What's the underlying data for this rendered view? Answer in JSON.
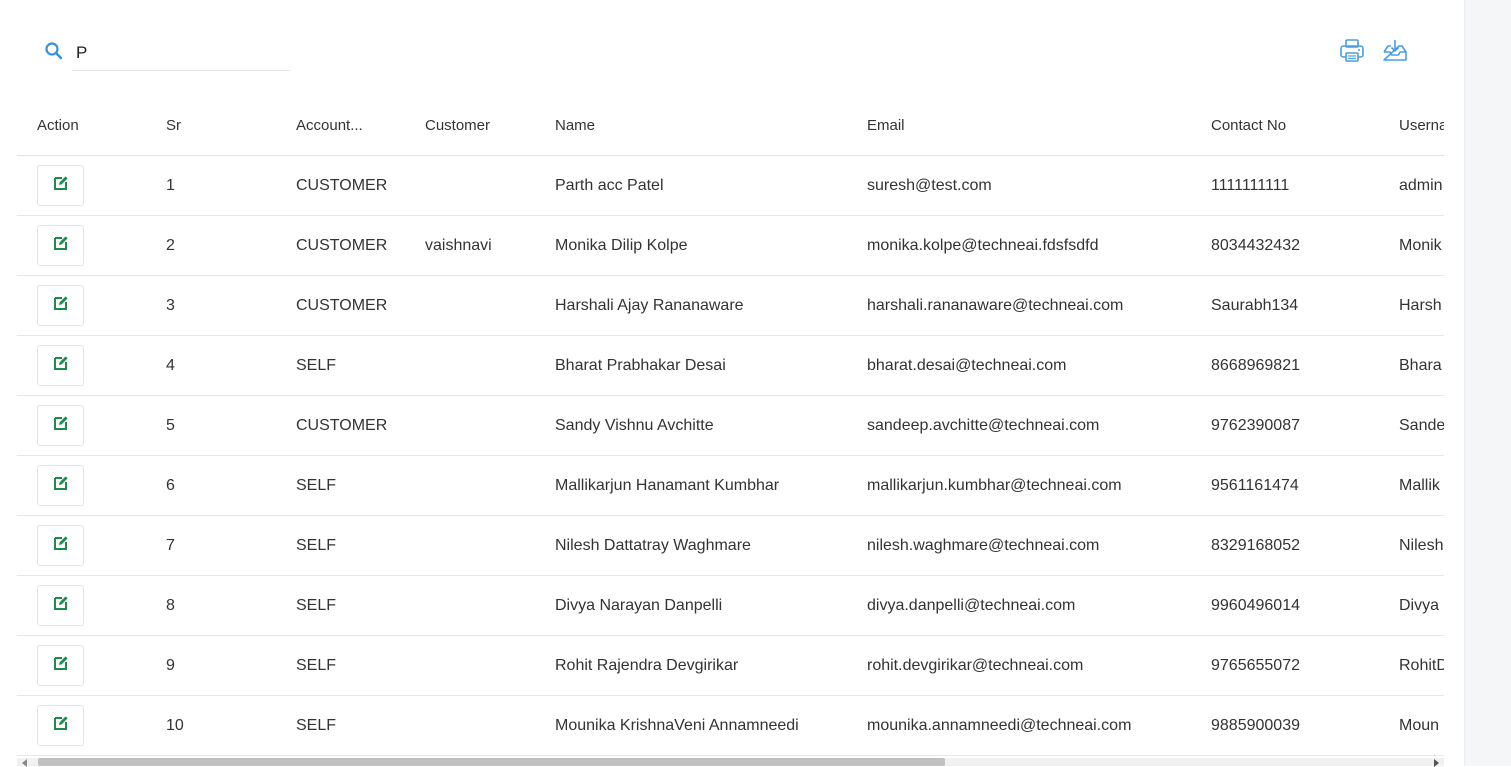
{
  "search": {
    "value": "P",
    "placeholder": ""
  },
  "toolbar": {
    "print_icon": "printer-icon",
    "download_icon": "download-tray-icon"
  },
  "colors": {
    "accent": "#3a8fd6",
    "edit_icon": "#1e8a4d"
  },
  "table": {
    "columns": [
      "Action",
      "Sr",
      "Account...",
      "Customer",
      "Name",
      "Email",
      "Contact No",
      "Userna"
    ],
    "rows": [
      {
        "sr": "1",
        "account": "CUSTOMER",
        "customer": "",
        "name": "Parth acc Patel",
        "email": "suresh@test.com",
        "contact": "1111111111",
        "username": "admin"
      },
      {
        "sr": "2",
        "account": "CUSTOMER",
        "customer": "vaishnavi",
        "name": "Monika Dilip Kolpe",
        "email": "monika.kolpe@techneai.fdsfsdfd",
        "contact": "8034432432",
        "username": "Monik"
      },
      {
        "sr": "3",
        "account": "CUSTOMER",
        "customer": "",
        "name": "Harshali Ajay Rananaware",
        "email": "harshali.rananaware@techneai.com",
        "contact": "Saurabh134",
        "username": "Harsh"
      },
      {
        "sr": "4",
        "account": "SELF",
        "customer": "",
        "name": "Bharat Prabhakar Desai",
        "email": "bharat.desai@techneai.com",
        "contact": "8668969821",
        "username": "Bhara"
      },
      {
        "sr": "5",
        "account": "CUSTOMER",
        "customer": "",
        "name": "Sandy Vishnu Avchitte",
        "email": "sandeep.avchitte@techneai.com",
        "contact": "9762390087",
        "username": "Sande"
      },
      {
        "sr": "6",
        "account": "SELF",
        "customer": "",
        "name": "Mallikarjun Hanamant Kumbhar",
        "email": "mallikarjun.kumbhar@techneai.com",
        "contact": "9561161474",
        "username": "Mallik"
      },
      {
        "sr": "7",
        "account": "SELF",
        "customer": "",
        "name": "Nilesh Dattatray Waghmare",
        "email": "nilesh.waghmare@techneai.com",
        "contact": "8329168052",
        "username": "Nilesh"
      },
      {
        "sr": "8",
        "account": "SELF",
        "customer": "",
        "name": "Divya Narayan Danpelli",
        "email": "divya.danpelli@techneai.com",
        "contact": "9960496014",
        "username": "Divya"
      },
      {
        "sr": "9",
        "account": "SELF",
        "customer": "",
        "name": "Rohit Rajendra Devgirikar",
        "email": "rohit.devgirikar@techneai.com",
        "contact": "9765655072",
        "username": "RohitD"
      },
      {
        "sr": "10",
        "account": "SELF",
        "customer": "",
        "name": "Mounika KrishnaVeni Annamneedi",
        "email": "mounika.annamneedi@techneai.com",
        "contact": "9885900039",
        "username": "Moun"
      }
    ]
  }
}
